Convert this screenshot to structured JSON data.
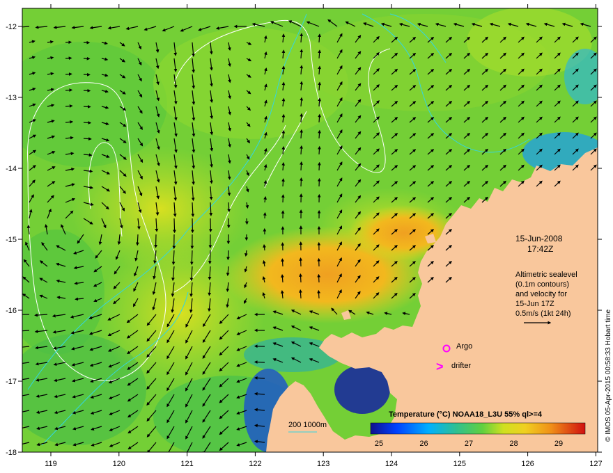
{
  "map": {
    "date": "15-Jun-2008",
    "time": "17:42Z",
    "legend_lines": [
      "Altimetric sealevel",
      "(0.1m contours)",
      "and velocity for",
      "15-Jun 17Z",
      "0.5m/s (1kt 24h)"
    ],
    "argo_label": "Argo",
    "drifter_label": "drifter",
    "drifter_symbol": ">",
    "depth_label": "200  1000m",
    "colorbar_title": "Temperature (°C) NOAA18_L3U 55% ql>=4",
    "colorbar_ticks": [
      "25",
      "26",
      "27",
      "28",
      "29"
    ],
    "credit": "© IMOS 05-Apr-2015 00:58:33 Hobart time",
    "x_ticks": [
      "119",
      "120",
      "121",
      "122",
      "123",
      "124",
      "125",
      "126",
      "127"
    ],
    "y_ticks": [
      "-12",
      "-13",
      "-14",
      "-15",
      "-16",
      "-17",
      "-18"
    ],
    "colors": {
      "land": "#f9c79c",
      "contour_white": "#ffffff",
      "contour_cyan": "#33d6e0",
      "marker": "#ff00ff"
    }
  }
}
